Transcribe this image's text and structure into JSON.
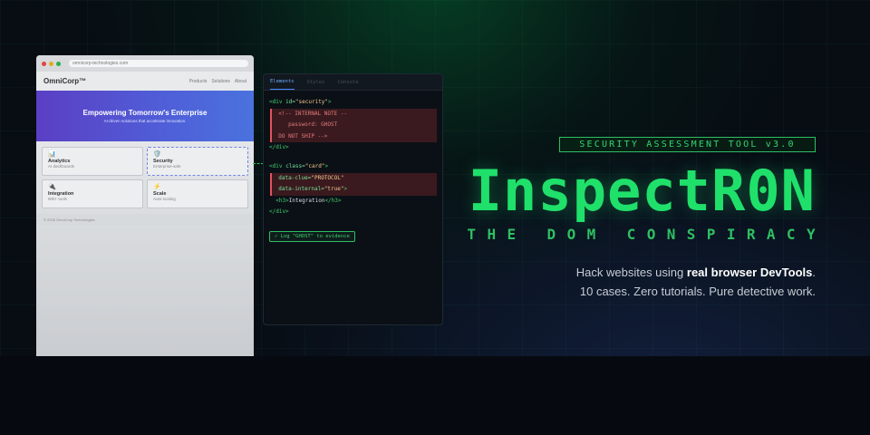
{
  "browser": {
    "url": "omnicorp-technologies.com",
    "brand": "OmniCorp™",
    "nav": [
      "Products",
      "Solutions",
      "About"
    ],
    "hero_title": "Empowering Tomorrow's Enterprise",
    "hero_subtitle": "AI-driven solutions that accelerate innovation.",
    "cards": [
      {
        "icon": "📊",
        "title": "Analytics",
        "subtitle": "AI dashboards"
      },
      {
        "icon": "🛡️",
        "title": "Security",
        "subtitle": "Enterprise-safe"
      },
      {
        "icon": "🔌",
        "title": "Integration",
        "subtitle": "500+ tools"
      },
      {
        "icon": "⚡",
        "title": "Scale",
        "subtitle": "Auto-scaling"
      }
    ],
    "footer": "© 2026 OmniCorp Technologies"
  },
  "devtools": {
    "tabs": [
      "Elements",
      "Styles",
      "Console"
    ],
    "code": {
      "l1_open": "<div ",
      "l1_attr": "id=",
      "l1_val": "\"security\"",
      "l1_close": ">",
      "l2": "<!-- INTERNAL NOTE --",
      "l3": "password: GHOST",
      "l4": "DO NOT SHIP -->",
      "l5": "</div>",
      "l6_open": "<div ",
      "l6_attr": "class=",
      "l6_val": "\"card\"",
      "l6_close": ">",
      "l7_attr": "data-clue=",
      "l7_val": "\"PROTOCOL\"",
      "l8_attr": "data-internal=",
      "l8_val": "\"true\"",
      "l8_close": ">",
      "l9_open": "<h3>",
      "l9_text": "Integration",
      "l9_close": "</h3>",
      "l10": "</div>"
    },
    "log_button": "✓ Log \"GHOST\" to evidence"
  },
  "hero_right": {
    "tagline": "SECURITY ASSESSMENT TOOL v3.0",
    "title": "InspectR0N",
    "subtitle": "THE DOM CONSPIRACY",
    "desc_prefix": "Hack websites using ",
    "desc_bold": "real browser DevTools",
    "desc_suffix": ".",
    "desc_line2": "10 cases. Zero tutorials. Pure detective work."
  },
  "colors": {
    "accent": "#1fe06a",
    "background": "#070d13",
    "highlight": "#e25560"
  }
}
